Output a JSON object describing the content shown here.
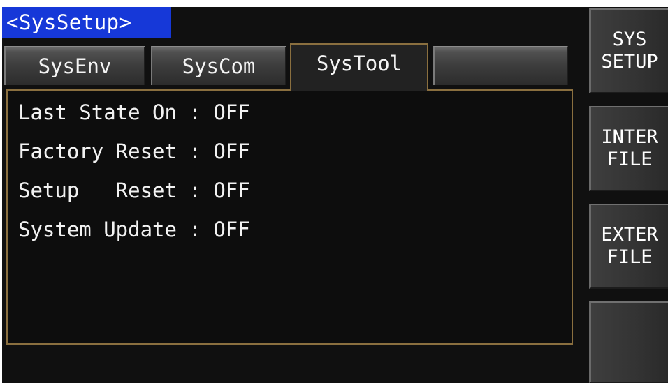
{
  "screen": {
    "title": "<SysSetup>",
    "accent_color": "#1638d8",
    "panel_border_color": "#8a6f3f"
  },
  "tabs": [
    {
      "label": "SysEnv",
      "active": false
    },
    {
      "label": "SysCom",
      "active": false
    },
    {
      "label": "SysTool",
      "active": true
    },
    {
      "label": "",
      "active": false
    }
  ],
  "settings": [
    {
      "text": "Last State On : OFF"
    },
    {
      "text": "Factory Reset : OFF"
    },
    {
      "text": "Setup   Reset : OFF"
    },
    {
      "text": "System Update : OFF"
    }
  ],
  "softkeys": [
    {
      "line1": "SYS",
      "line2": "SETUP"
    },
    {
      "line1": "INTER",
      "line2": "FILE"
    },
    {
      "line1": "EXTER",
      "line2": "FILE"
    },
    {
      "line1": "",
      "line2": ""
    }
  ]
}
